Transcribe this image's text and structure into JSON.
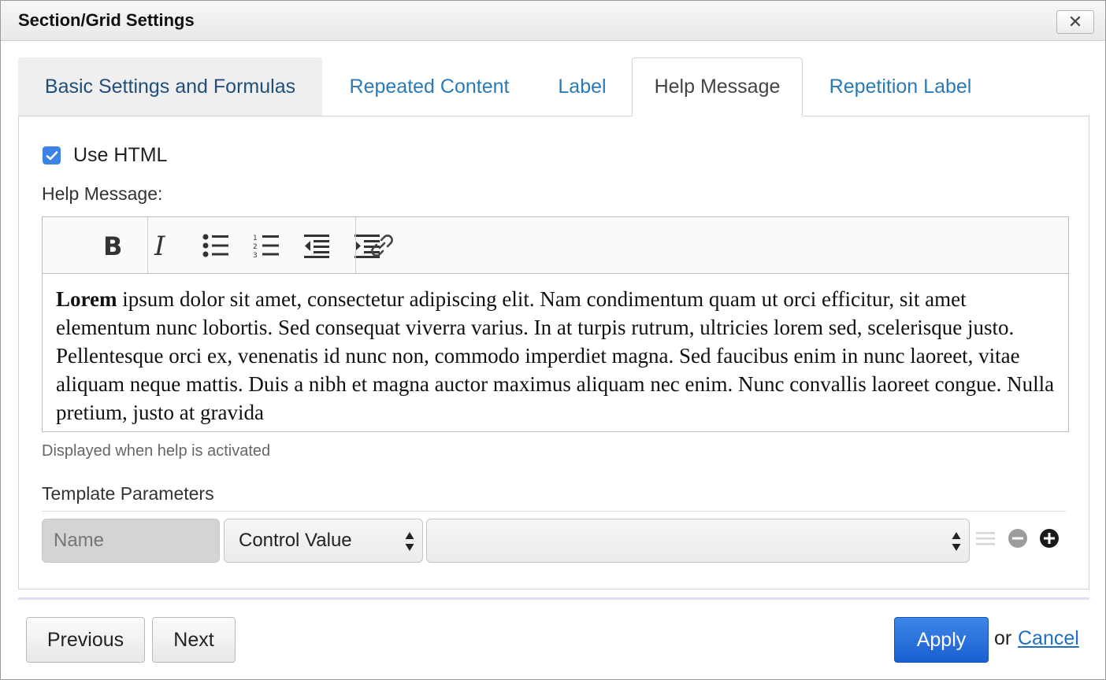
{
  "dialog": {
    "title": "Section/Grid Settings",
    "close_icon": "close-icon"
  },
  "tabs": [
    {
      "label": "Basic Settings and Formulas",
      "active": false
    },
    {
      "label": "Repeated Content",
      "active": false
    },
    {
      "label": "Label",
      "active": false
    },
    {
      "label": "Help Message",
      "active": true
    },
    {
      "label": "Repetition Label",
      "active": false
    }
  ],
  "help": {
    "use_html_label": "Use HTML",
    "use_html_checked": true,
    "field_label": "Help Message:",
    "toolbar_icons": [
      "bold-icon",
      "italic-icon",
      "bulleted-list-icon",
      "numbered-list-icon",
      "outdent-icon",
      "indent-icon",
      "link-icon"
    ],
    "content_bold": "Lorem",
    "content_rest": " ipsum dolor sit amet, consectetur adipiscing elit. Nam condimentum quam ut orci efficitur, sit amet elementum nunc lobortis. Sed consequat viverra varius. In at turpis rutrum, ultricies lorem sed, scelerisque justo. Pellentesque orci ex, venenatis id nunc non, commodo imperdiet magna. Sed faucibus enim in nunc laoreet, vitae aliquam neque mattis. Duis a nibh et magna auctor maximus aliquam nec enim. Nunc convallis laoreet congue. Nulla pretium, justo at gravida",
    "hint": "Displayed when help is activated"
  },
  "template_parameters": {
    "label": "Template Parameters",
    "name_placeholder": "Name",
    "type_value": "Control Value",
    "value_value": ""
  },
  "footer": {
    "previous_label": "Previous",
    "next_label": "Next",
    "apply_label": "Apply",
    "or_text": "or",
    "cancel_label": "Cancel"
  },
  "colors": {
    "accent": "#3b83e6",
    "tab_link": "#2a7ab8",
    "apply": "#1a5fd0"
  }
}
